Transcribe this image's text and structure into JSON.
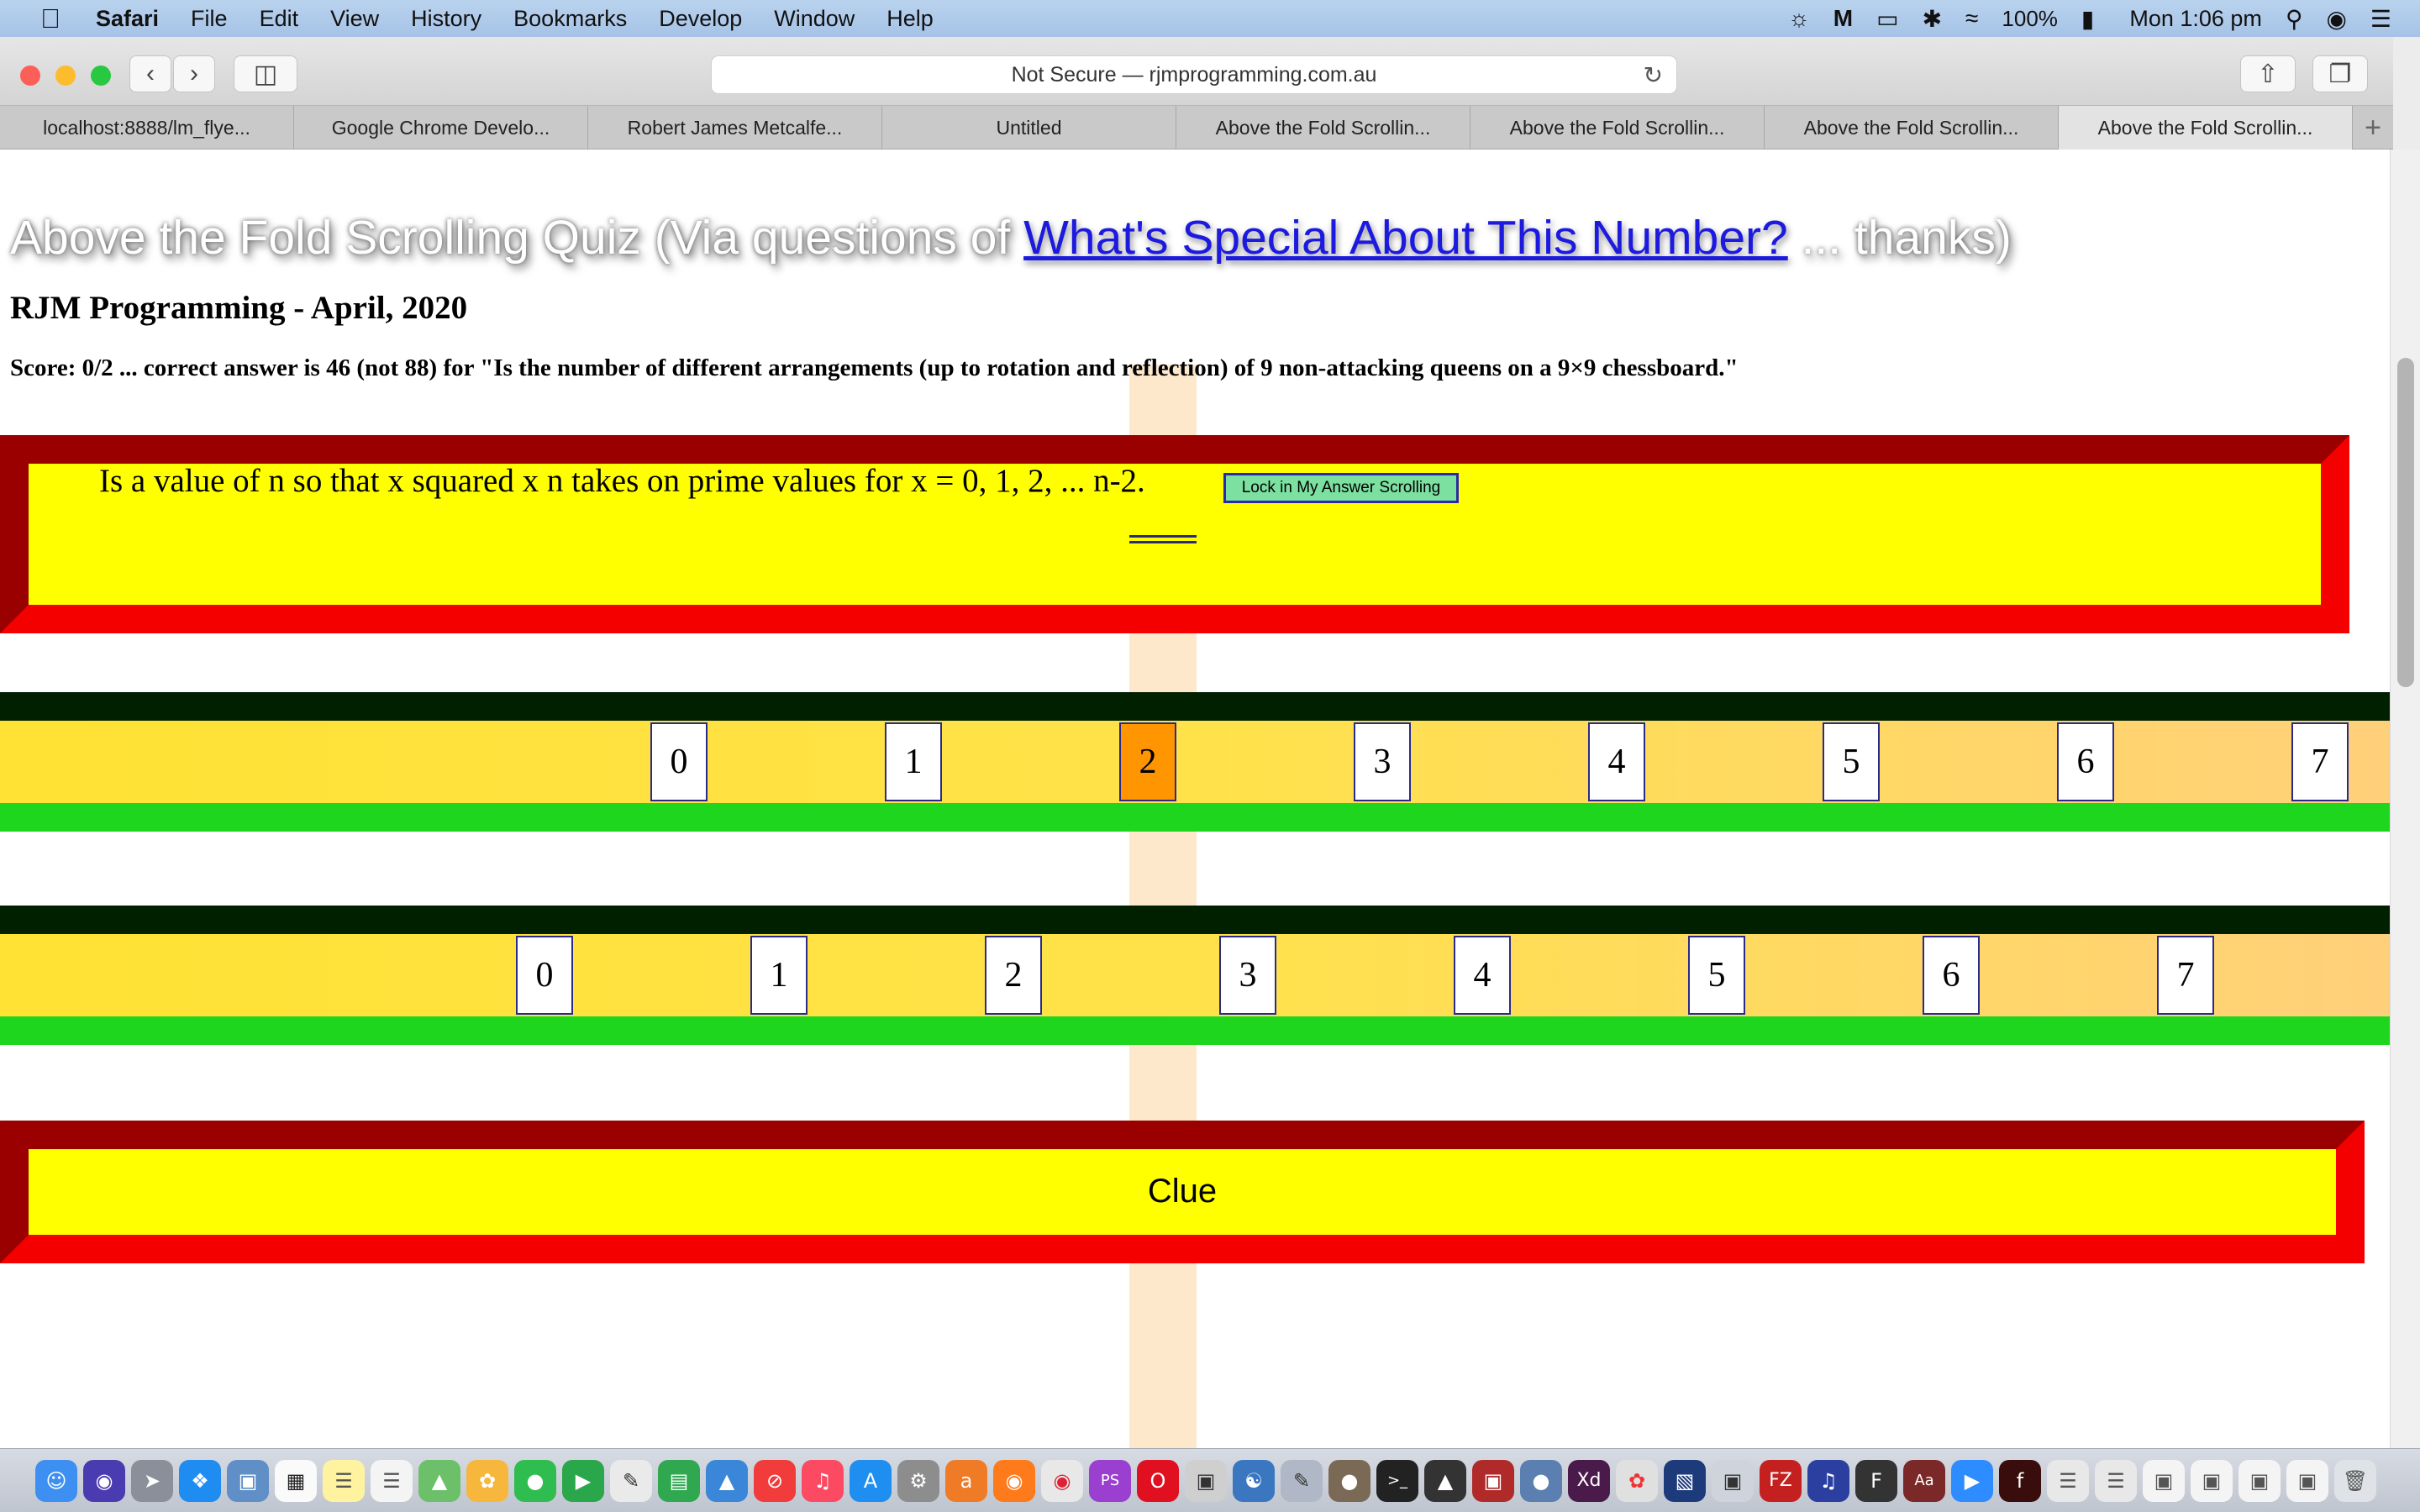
{
  "menubar": {
    "app_name": "Safari",
    "items": [
      "File",
      "Edit",
      "View",
      "History",
      "Bookmarks",
      "Develop",
      "Window",
      "Help"
    ],
    "battery": "100%",
    "clock": "Mon 1:06 pm"
  },
  "browser": {
    "address": "Not Secure — rjmprogramming.com.au",
    "tabs": [
      {
        "label": "localhost:8888/lm_flye..."
      },
      {
        "label": "Google Chrome Develo..."
      },
      {
        "label": "Robert James Metcalfe..."
      },
      {
        "label": "Untitled"
      },
      {
        "label": "Above the Fold Scrollin..."
      },
      {
        "label": "Above the Fold Scrollin..."
      },
      {
        "label": "Above the Fold Scrollin..."
      },
      {
        "label": "Above the Fold Scrollin..."
      }
    ],
    "new_tab": "+"
  },
  "page": {
    "title_prefix": "Above the Fold Scrolling Quiz (Via questions of ",
    "title_link": "What's Special About This Number?",
    "title_suffix": " ... thanks)",
    "subtitle": "RJM Programming - April, 2020",
    "score": "Score: 0/2 ... correct answer is 46 (not 88) for \"Is the number of different arrangements (up to rotation and reflection) of 9 non-attacking queens on a 9×9 chessboard.\"",
    "question": "Is a value of n so that x squared x n takes on prime values for x = 0, 1, 2, ... n-2.",
    "lock_button": "Lock in My Answer Scrolling",
    "clue_label": "Clue",
    "row1_digits": [
      "0",
      "1",
      "2",
      "3",
      "4",
      "5",
      "6",
      "7"
    ],
    "row1_selected": 2,
    "row2_digits": [
      "0",
      "1",
      "2",
      "3",
      "4",
      "5",
      "6",
      "7"
    ],
    "colors": {
      "frame_red": "#f50000",
      "frame_dark": "#9a0000",
      "panel_yellow": "#ffff00",
      "strip_dark": "#002000",
      "strip_green": "#1ed61e",
      "selected_digit": "#ff9500",
      "guide_band": "#fde8cc"
    }
  }
}
